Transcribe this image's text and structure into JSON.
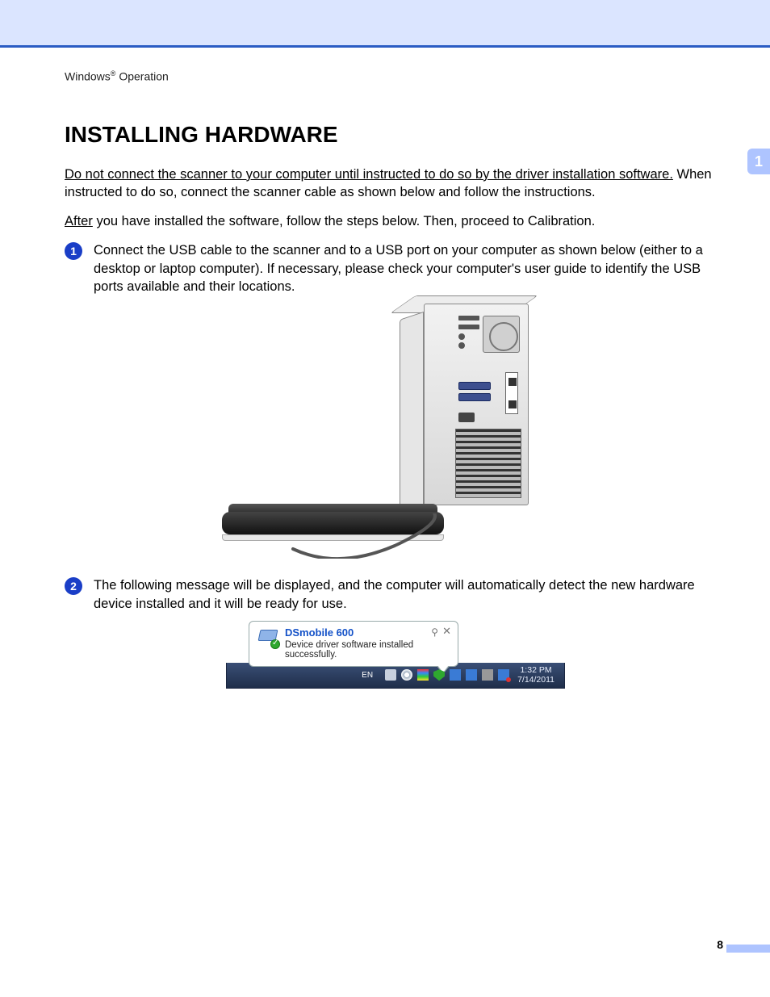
{
  "breadcrumb": {
    "os": "Windows",
    "reg": "®",
    "section": "Operation"
  },
  "title": "INSTALLING HARDWARE",
  "chapter": {
    "number": "1"
  },
  "intro": {
    "warning_underlined": "Do not connect the scanner to your computer until instructed to do so by the driver installation software.",
    "warning_rest": "When instructed to do so, connect the scanner cable as shown below and follow the instructions.",
    "after_underlined": "After",
    "after_rest": "you have installed the software, follow the steps below. Then, proceed to Calibration."
  },
  "steps": [
    {
      "num": "1",
      "text": "Connect the USB cable to the scanner and to a USB port on your computer as shown below (either to a desktop or laptop computer). If necessary, please check your computer's user guide to identify the USB ports available and their locations."
    },
    {
      "num": "2",
      "text": "The following message will be displayed, and the computer will automatically detect the new hardware device installed and it will be ready for use."
    }
  ],
  "notification": {
    "title": "DSmobile 600",
    "message": "Device driver software installed successfully."
  },
  "taskbar": {
    "lang": "EN",
    "time": "1:32 PM",
    "date": "7/14/2011"
  },
  "page_number": "8"
}
